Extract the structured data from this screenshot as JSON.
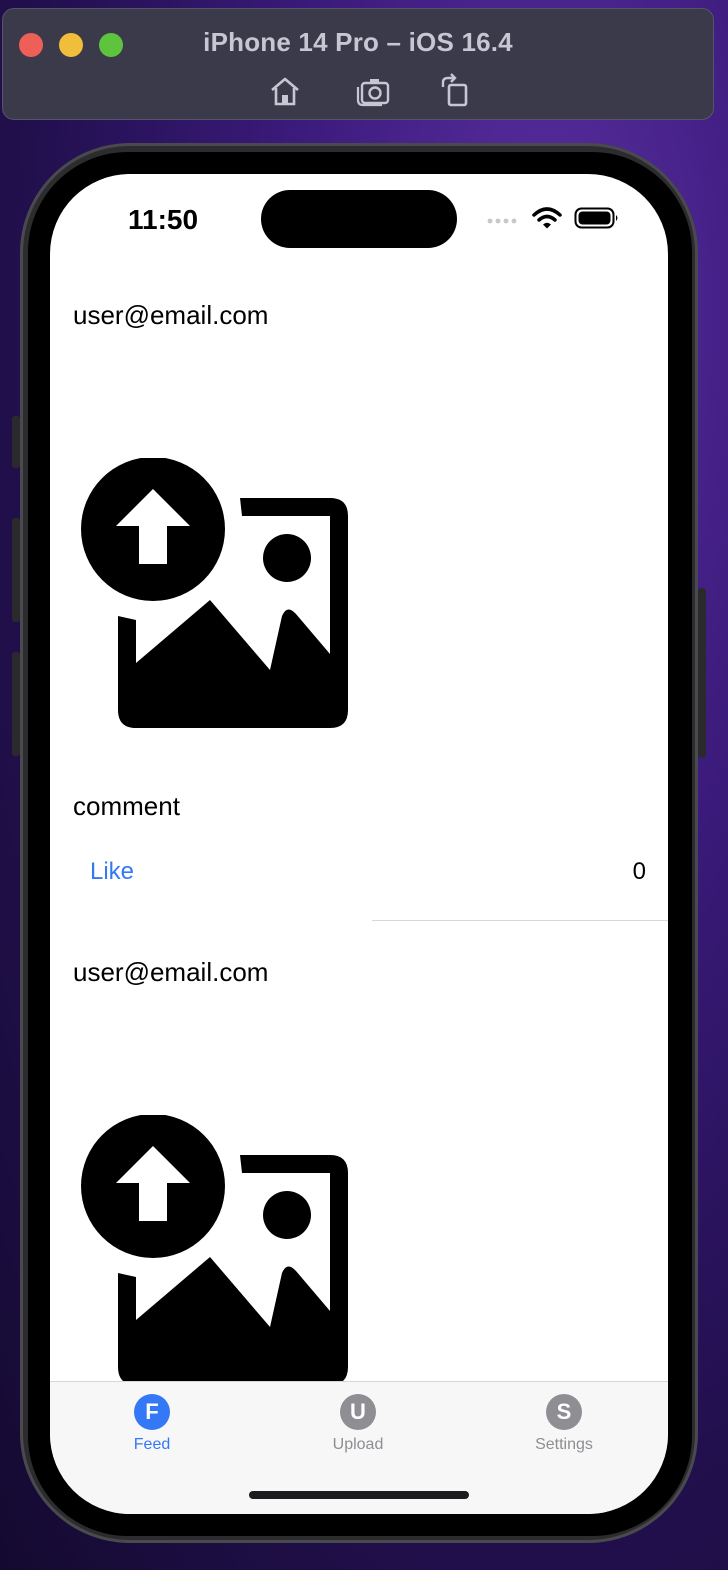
{
  "window": {
    "title": "iPhone 14 Pro – iOS 16.4",
    "toolbar_icons": [
      "home-icon",
      "screenshot-icon",
      "rotate-icon"
    ]
  },
  "status_bar": {
    "time": "11:50",
    "icons": [
      "cellular-icon",
      "wifi-icon",
      "battery-icon"
    ]
  },
  "feed": {
    "posts": [
      {
        "email": "user@email.com",
        "image_icon": "upload-image-icon",
        "comment": "comment",
        "like_label": "Like",
        "like_count": "0"
      },
      {
        "email": "user@email.com",
        "image_icon": "upload-image-icon"
      }
    ]
  },
  "tabbar": {
    "accent_color": "#3478f6",
    "inactive_color": "#8e8e93",
    "tabs": [
      {
        "letter": "F",
        "label": "Feed",
        "selected": true
      },
      {
        "letter": "U",
        "label": "Upload",
        "selected": false
      },
      {
        "letter": "S",
        "label": "Settings",
        "selected": false
      }
    ]
  }
}
